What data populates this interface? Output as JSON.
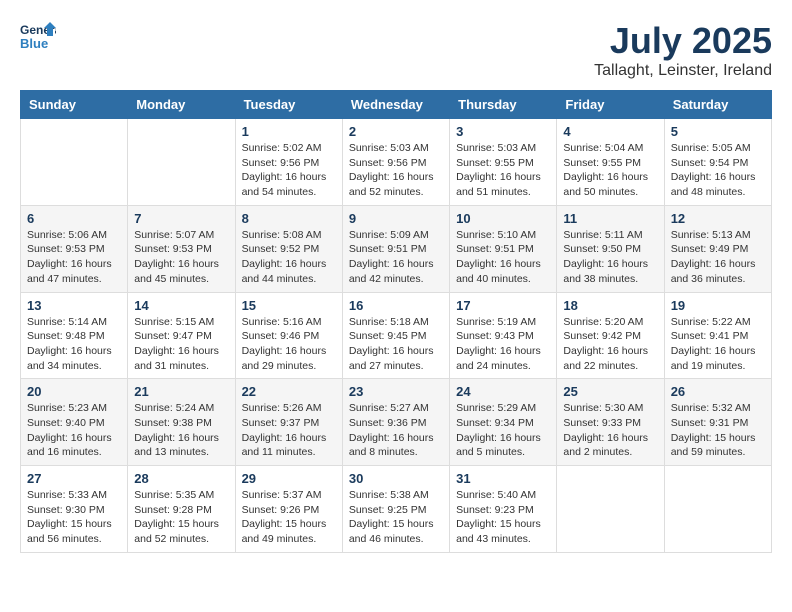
{
  "header": {
    "logo_line1": "General",
    "logo_line2": "Blue",
    "month_title": "July 2025",
    "location": "Tallaght, Leinster, Ireland"
  },
  "weekdays": [
    "Sunday",
    "Monday",
    "Tuesday",
    "Wednesday",
    "Thursday",
    "Friday",
    "Saturday"
  ],
  "weeks": [
    [
      {
        "day": "",
        "info": ""
      },
      {
        "day": "",
        "info": ""
      },
      {
        "day": "1",
        "info": "Sunrise: 5:02 AM\nSunset: 9:56 PM\nDaylight: 16 hours and 54 minutes."
      },
      {
        "day": "2",
        "info": "Sunrise: 5:03 AM\nSunset: 9:56 PM\nDaylight: 16 hours and 52 minutes."
      },
      {
        "day": "3",
        "info": "Sunrise: 5:03 AM\nSunset: 9:55 PM\nDaylight: 16 hours and 51 minutes."
      },
      {
        "day": "4",
        "info": "Sunrise: 5:04 AM\nSunset: 9:55 PM\nDaylight: 16 hours and 50 minutes."
      },
      {
        "day": "5",
        "info": "Sunrise: 5:05 AM\nSunset: 9:54 PM\nDaylight: 16 hours and 48 minutes."
      }
    ],
    [
      {
        "day": "6",
        "info": "Sunrise: 5:06 AM\nSunset: 9:53 PM\nDaylight: 16 hours and 47 minutes."
      },
      {
        "day": "7",
        "info": "Sunrise: 5:07 AM\nSunset: 9:53 PM\nDaylight: 16 hours and 45 minutes."
      },
      {
        "day": "8",
        "info": "Sunrise: 5:08 AM\nSunset: 9:52 PM\nDaylight: 16 hours and 44 minutes."
      },
      {
        "day": "9",
        "info": "Sunrise: 5:09 AM\nSunset: 9:51 PM\nDaylight: 16 hours and 42 minutes."
      },
      {
        "day": "10",
        "info": "Sunrise: 5:10 AM\nSunset: 9:51 PM\nDaylight: 16 hours and 40 minutes."
      },
      {
        "day": "11",
        "info": "Sunrise: 5:11 AM\nSunset: 9:50 PM\nDaylight: 16 hours and 38 minutes."
      },
      {
        "day": "12",
        "info": "Sunrise: 5:13 AM\nSunset: 9:49 PM\nDaylight: 16 hours and 36 minutes."
      }
    ],
    [
      {
        "day": "13",
        "info": "Sunrise: 5:14 AM\nSunset: 9:48 PM\nDaylight: 16 hours and 34 minutes."
      },
      {
        "day": "14",
        "info": "Sunrise: 5:15 AM\nSunset: 9:47 PM\nDaylight: 16 hours and 31 minutes."
      },
      {
        "day": "15",
        "info": "Sunrise: 5:16 AM\nSunset: 9:46 PM\nDaylight: 16 hours and 29 minutes."
      },
      {
        "day": "16",
        "info": "Sunrise: 5:18 AM\nSunset: 9:45 PM\nDaylight: 16 hours and 27 minutes."
      },
      {
        "day": "17",
        "info": "Sunrise: 5:19 AM\nSunset: 9:43 PM\nDaylight: 16 hours and 24 minutes."
      },
      {
        "day": "18",
        "info": "Sunrise: 5:20 AM\nSunset: 9:42 PM\nDaylight: 16 hours and 22 minutes."
      },
      {
        "day": "19",
        "info": "Sunrise: 5:22 AM\nSunset: 9:41 PM\nDaylight: 16 hours and 19 minutes."
      }
    ],
    [
      {
        "day": "20",
        "info": "Sunrise: 5:23 AM\nSunset: 9:40 PM\nDaylight: 16 hours and 16 minutes."
      },
      {
        "day": "21",
        "info": "Sunrise: 5:24 AM\nSunset: 9:38 PM\nDaylight: 16 hours and 13 minutes."
      },
      {
        "day": "22",
        "info": "Sunrise: 5:26 AM\nSunset: 9:37 PM\nDaylight: 16 hours and 11 minutes."
      },
      {
        "day": "23",
        "info": "Sunrise: 5:27 AM\nSunset: 9:36 PM\nDaylight: 16 hours and 8 minutes."
      },
      {
        "day": "24",
        "info": "Sunrise: 5:29 AM\nSunset: 9:34 PM\nDaylight: 16 hours and 5 minutes."
      },
      {
        "day": "25",
        "info": "Sunrise: 5:30 AM\nSunset: 9:33 PM\nDaylight: 16 hours and 2 minutes."
      },
      {
        "day": "26",
        "info": "Sunrise: 5:32 AM\nSunset: 9:31 PM\nDaylight: 15 hours and 59 minutes."
      }
    ],
    [
      {
        "day": "27",
        "info": "Sunrise: 5:33 AM\nSunset: 9:30 PM\nDaylight: 15 hours and 56 minutes."
      },
      {
        "day": "28",
        "info": "Sunrise: 5:35 AM\nSunset: 9:28 PM\nDaylight: 15 hours and 52 minutes."
      },
      {
        "day": "29",
        "info": "Sunrise: 5:37 AM\nSunset: 9:26 PM\nDaylight: 15 hours and 49 minutes."
      },
      {
        "day": "30",
        "info": "Sunrise: 5:38 AM\nSunset: 9:25 PM\nDaylight: 15 hours and 46 minutes."
      },
      {
        "day": "31",
        "info": "Sunrise: 5:40 AM\nSunset: 9:23 PM\nDaylight: 15 hours and 43 minutes."
      },
      {
        "day": "",
        "info": ""
      },
      {
        "day": "",
        "info": ""
      }
    ]
  ]
}
